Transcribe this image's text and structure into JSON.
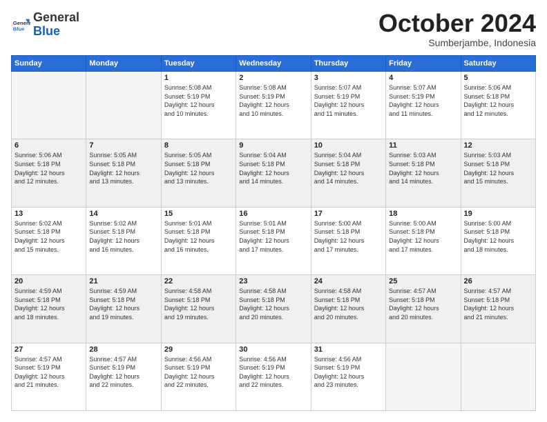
{
  "logo": {
    "line1": "General",
    "line2": "Blue"
  },
  "header": {
    "month": "October 2024",
    "location": "Sumberjambe, Indonesia"
  },
  "weekdays": [
    "Sunday",
    "Monday",
    "Tuesday",
    "Wednesday",
    "Thursday",
    "Friday",
    "Saturday"
  ],
  "weeks": [
    [
      {
        "day": "",
        "info": ""
      },
      {
        "day": "",
        "info": ""
      },
      {
        "day": "1",
        "info": "Sunrise: 5:08 AM\nSunset: 5:19 PM\nDaylight: 12 hours\nand 10 minutes."
      },
      {
        "day": "2",
        "info": "Sunrise: 5:08 AM\nSunset: 5:19 PM\nDaylight: 12 hours\nand 10 minutes."
      },
      {
        "day": "3",
        "info": "Sunrise: 5:07 AM\nSunset: 5:19 PM\nDaylight: 12 hours\nand 11 minutes."
      },
      {
        "day": "4",
        "info": "Sunrise: 5:07 AM\nSunset: 5:19 PM\nDaylight: 12 hours\nand 11 minutes."
      },
      {
        "day": "5",
        "info": "Sunrise: 5:06 AM\nSunset: 5:18 PM\nDaylight: 12 hours\nand 12 minutes."
      }
    ],
    [
      {
        "day": "6",
        "info": "Sunrise: 5:06 AM\nSunset: 5:18 PM\nDaylight: 12 hours\nand 12 minutes."
      },
      {
        "day": "7",
        "info": "Sunrise: 5:05 AM\nSunset: 5:18 PM\nDaylight: 12 hours\nand 13 minutes."
      },
      {
        "day": "8",
        "info": "Sunrise: 5:05 AM\nSunset: 5:18 PM\nDaylight: 12 hours\nand 13 minutes."
      },
      {
        "day": "9",
        "info": "Sunrise: 5:04 AM\nSunset: 5:18 PM\nDaylight: 12 hours\nand 14 minutes."
      },
      {
        "day": "10",
        "info": "Sunrise: 5:04 AM\nSunset: 5:18 PM\nDaylight: 12 hours\nand 14 minutes."
      },
      {
        "day": "11",
        "info": "Sunrise: 5:03 AM\nSunset: 5:18 PM\nDaylight: 12 hours\nand 14 minutes."
      },
      {
        "day": "12",
        "info": "Sunrise: 5:03 AM\nSunset: 5:18 PM\nDaylight: 12 hours\nand 15 minutes."
      }
    ],
    [
      {
        "day": "13",
        "info": "Sunrise: 5:02 AM\nSunset: 5:18 PM\nDaylight: 12 hours\nand 15 minutes."
      },
      {
        "day": "14",
        "info": "Sunrise: 5:02 AM\nSunset: 5:18 PM\nDaylight: 12 hours\nand 16 minutes."
      },
      {
        "day": "15",
        "info": "Sunrise: 5:01 AM\nSunset: 5:18 PM\nDaylight: 12 hours\nand 16 minutes."
      },
      {
        "day": "16",
        "info": "Sunrise: 5:01 AM\nSunset: 5:18 PM\nDaylight: 12 hours\nand 17 minutes."
      },
      {
        "day": "17",
        "info": "Sunrise: 5:00 AM\nSunset: 5:18 PM\nDaylight: 12 hours\nand 17 minutes."
      },
      {
        "day": "18",
        "info": "Sunrise: 5:00 AM\nSunset: 5:18 PM\nDaylight: 12 hours\nand 17 minutes."
      },
      {
        "day": "19",
        "info": "Sunrise: 5:00 AM\nSunset: 5:18 PM\nDaylight: 12 hours\nand 18 minutes."
      }
    ],
    [
      {
        "day": "20",
        "info": "Sunrise: 4:59 AM\nSunset: 5:18 PM\nDaylight: 12 hours\nand 18 minutes."
      },
      {
        "day": "21",
        "info": "Sunrise: 4:59 AM\nSunset: 5:18 PM\nDaylight: 12 hours\nand 19 minutes."
      },
      {
        "day": "22",
        "info": "Sunrise: 4:58 AM\nSunset: 5:18 PM\nDaylight: 12 hours\nand 19 minutes."
      },
      {
        "day": "23",
        "info": "Sunrise: 4:58 AM\nSunset: 5:18 PM\nDaylight: 12 hours\nand 20 minutes."
      },
      {
        "day": "24",
        "info": "Sunrise: 4:58 AM\nSunset: 5:18 PM\nDaylight: 12 hours\nand 20 minutes."
      },
      {
        "day": "25",
        "info": "Sunrise: 4:57 AM\nSunset: 5:18 PM\nDaylight: 12 hours\nand 20 minutes."
      },
      {
        "day": "26",
        "info": "Sunrise: 4:57 AM\nSunset: 5:18 PM\nDaylight: 12 hours\nand 21 minutes."
      }
    ],
    [
      {
        "day": "27",
        "info": "Sunrise: 4:57 AM\nSunset: 5:19 PM\nDaylight: 12 hours\nand 21 minutes."
      },
      {
        "day": "28",
        "info": "Sunrise: 4:57 AM\nSunset: 5:19 PM\nDaylight: 12 hours\nand 22 minutes."
      },
      {
        "day": "29",
        "info": "Sunrise: 4:56 AM\nSunset: 5:19 PM\nDaylight: 12 hours\nand 22 minutes."
      },
      {
        "day": "30",
        "info": "Sunrise: 4:56 AM\nSunset: 5:19 PM\nDaylight: 12 hours\nand 22 minutes."
      },
      {
        "day": "31",
        "info": "Sunrise: 4:56 AM\nSunset: 5:19 PM\nDaylight: 12 hours\nand 23 minutes."
      },
      {
        "day": "",
        "info": ""
      },
      {
        "day": "",
        "info": ""
      }
    ]
  ]
}
